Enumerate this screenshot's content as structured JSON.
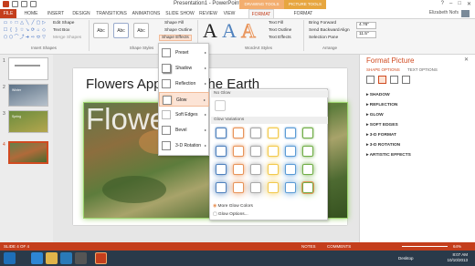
{
  "window": {
    "title": "Presentation1 - PowerPoint",
    "context_drawing": "DRAWING TOOLS",
    "context_picture": "PICTURE TOOLS",
    "controls": [
      "?",
      "–",
      "□",
      "✕"
    ]
  },
  "tabs": [
    "FILE",
    "HOME",
    "INSERT",
    "DESIGN",
    "TRANSITIONS",
    "ANIMATIONS",
    "SLIDE SHOW",
    "REVIEW",
    "VIEW",
    "FORMAT",
    "FORMAT"
  ],
  "user": {
    "name": "Elizabeth Nofs"
  },
  "ribbon": {
    "insert_shapes": {
      "label": "Insert Shapes",
      "edit_shape": "Edit Shape",
      "text_box": "Text Box",
      "merge_shapes": "Merge Shapes",
      "shape_glyphs": [
        "▭",
        "○",
        "□",
        "△",
        "╲",
        "╱",
        "▢",
        "▷",
        "☐",
        "{",
        "}",
        "☆",
        "↘",
        "⟳",
        "⌂",
        "◇",
        "⬠",
        "⬡",
        "⌒",
        "⤴",
        "➜",
        "⇨",
        "⬭",
        "▽"
      ]
    },
    "shape_styles": {
      "label": "Shape Styles",
      "swatches": [
        "Abc",
        "Abc",
        "Abc"
      ],
      "fill": "Shape Fill",
      "outline": "Shape Outline",
      "effects": "Shape Effects"
    },
    "wordart": {
      "label": "WordArt Styles",
      "text_fill": "Text Fill",
      "text_outline": "Text Outline",
      "text_effects": "Text Effects",
      "letter": "A"
    },
    "arrange": {
      "label": "Arrange",
      "bring_forward": "Bring Forward",
      "send_backward": "Send Backward",
      "selection_pane": "Selection Pane",
      "align": "Align",
      "group": "Group",
      "rotate": "Rotate"
    },
    "size": {
      "height": "4.76\"",
      "width": "11.5\""
    }
  },
  "effects_menu": {
    "items": [
      "Preset",
      "Shadow",
      "Reflection",
      "Glow",
      "Soft Edges",
      "Bevel",
      "3-D Rotation"
    ],
    "highlighted": "Glow"
  },
  "glow_gallery": {
    "no_glow": "No Glow",
    "variations": "Glow Variations",
    "row_colors": [
      "#4f81bd",
      "#e8945a",
      "#aaaaaa",
      "#f2c94c",
      "#5b9bd5",
      "#70ad47"
    ],
    "more_colors": "More Glow Colors",
    "options": "Glow Options..."
  },
  "slides": {
    "numbers": [
      "1",
      "2",
      "3",
      "4"
    ],
    "thumb_titles": [
      "",
      "Winter",
      "Spring",
      ""
    ],
    "current": 4,
    "slide_title": "Flowers Appear on the Earth",
    "photo_text": "Flowe"
  },
  "format_pane": {
    "title": "Format Picture",
    "tabs": [
      "SHAPE OPTIONS",
      "TEXT OPTIONS"
    ],
    "sections": [
      "SHADOW",
      "REFLECTION",
      "GLOW",
      "SOFT EDGES",
      "3-D FORMAT",
      "3-D ROTATION",
      "ARTISTIC EFFECTS"
    ]
  },
  "status": {
    "slide_of": "SLIDE 4 OF 4",
    "notes": "NOTES",
    "comments": "COMMENTS",
    "zoom": "64%"
  },
  "taskbar": {
    "desktop": "Desktop",
    "time": "8:07 AM",
    "date": "10/10/2013"
  }
}
